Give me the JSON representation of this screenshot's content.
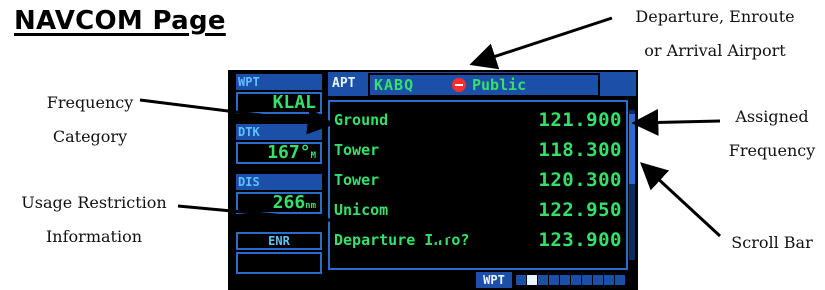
{
  "title": "NAVCOM Page",
  "callouts": {
    "frequency_category": "Frequency\nCategory",
    "usage_restriction": "Usage Restriction\nInformation",
    "airport": "Departure, Enroute\nor Arrival Airport",
    "assigned_frequency": "Assigned\nFrequency",
    "scroll_bar": "Scroll Bar"
  },
  "screen": {
    "left_panel": {
      "wpt_label": "WPT",
      "wpt_value": "KLAL",
      "dtk_label": "DTK",
      "dtk_value": "167°",
      "dtk_unit": "M",
      "dis_label": "DIS",
      "dis_value": "266",
      "dis_unit": "nm",
      "mode": "ENR"
    },
    "header": {
      "label": "APT",
      "airport_id": "KABQ",
      "airport_type": "Public",
      "airport_type_icon": "no-entry-icon"
    },
    "frequencies": [
      {
        "name": "Ground",
        "freq": "121.900"
      },
      {
        "name": "Tower",
        "freq": "118.300"
      },
      {
        "name": "Tower",
        "freq": "120.300"
      },
      {
        "name": "Unicom",
        "freq": "122.950"
      },
      {
        "name": "Departure Info?",
        "freq": "123.900"
      }
    ],
    "status_bar": {
      "page_group": "WPT",
      "page_count": 10,
      "active_page": 1
    },
    "colors": {
      "background": "#000000",
      "text_green": "#33e06a",
      "label_cyan": "#5ec2ff",
      "frame_blue": "#1c4fa8"
    }
  }
}
